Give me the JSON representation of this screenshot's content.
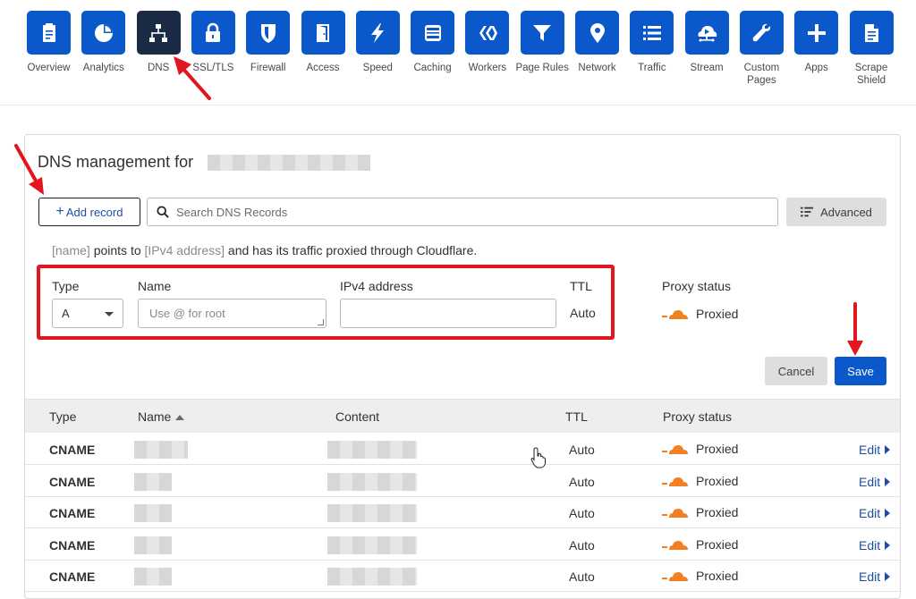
{
  "nav": {
    "items": [
      {
        "label": "Overview",
        "icon": "clipboard-icon",
        "name": "nav-overview",
        "active": false
      },
      {
        "label": "Analytics",
        "icon": "pie-chart-icon",
        "name": "nav-analytics",
        "active": false
      },
      {
        "label": "DNS",
        "icon": "network-tree-icon",
        "name": "nav-dns",
        "active": true
      },
      {
        "label": "SSL/TLS",
        "icon": "lock-icon",
        "name": "nav-ssl-tls",
        "active": false
      },
      {
        "label": "Firewall",
        "icon": "shield-icon",
        "name": "nav-firewall",
        "active": false
      },
      {
        "label": "Access",
        "icon": "door-icon",
        "name": "nav-access",
        "active": false
      },
      {
        "label": "Speed",
        "icon": "lightning-icon",
        "name": "nav-speed",
        "active": false
      },
      {
        "label": "Caching",
        "icon": "server-icon",
        "name": "nav-caching",
        "active": false
      },
      {
        "label": "Workers",
        "icon": "workers-icon",
        "name": "nav-workers",
        "active": false
      },
      {
        "label": "Page Rules",
        "icon": "filter-icon",
        "name": "nav-page-rules",
        "active": false
      },
      {
        "label": "Network",
        "icon": "location-pin-icon",
        "name": "nav-network",
        "active": false
      },
      {
        "label": "Traffic",
        "icon": "list-icon",
        "name": "nav-traffic",
        "active": false
      },
      {
        "label": "Stream",
        "icon": "cloud-play-icon",
        "name": "nav-stream",
        "active": false
      },
      {
        "label": "Custom\nPages",
        "icon": "wrench-icon",
        "name": "nav-custom-pages",
        "active": false
      },
      {
        "label": "Apps",
        "icon": "plus-icon",
        "name": "nav-apps",
        "active": false
      },
      {
        "label": "Scrape\nShield",
        "icon": "document-icon",
        "name": "nav-scrape-shield",
        "active": false
      }
    ]
  },
  "dns": {
    "title": "DNS management for",
    "add_record_label": "Add record",
    "search_placeholder": "Search DNS Records",
    "advanced_label": "Advanced",
    "hint": {
      "name_ph": "[name]",
      "mid1": " points to ",
      "ip_ph": "[IPv4 address]",
      "mid2": " and has its traffic proxied through Cloudflare."
    },
    "form": {
      "type_label": "Type",
      "type_value": "A",
      "name_label": "Name",
      "name_placeholder": "Use @ for root",
      "ipv4_label": "IPv4 address",
      "ttl_label": "TTL",
      "ttl_value": "Auto",
      "proxy_label": "Proxy status",
      "proxy_value": "Proxied"
    },
    "cancel_label": "Cancel",
    "save_label": "Save"
  },
  "table": {
    "headers": {
      "type": "Type",
      "name": "Name",
      "content": "Content",
      "ttl": "TTL",
      "proxy": "Proxy status"
    },
    "edit_label": "Edit",
    "rows": [
      {
        "type": "CNAME",
        "ttl": "Auto",
        "proxy": "Proxied"
      },
      {
        "type": "CNAME",
        "ttl": "Auto",
        "proxy": "Proxied"
      },
      {
        "type": "CNAME",
        "ttl": "Auto",
        "proxy": "Proxied"
      },
      {
        "type": "CNAME",
        "ttl": "Auto",
        "proxy": "Proxied"
      },
      {
        "type": "CNAME",
        "ttl": "Auto",
        "proxy": "Proxied"
      }
    ]
  },
  "colors": {
    "brand_blue": "#0a58c9",
    "active_tile": "#1b2b46",
    "cloud_orange": "#f38020",
    "annotation_red": "#e3151e"
  }
}
